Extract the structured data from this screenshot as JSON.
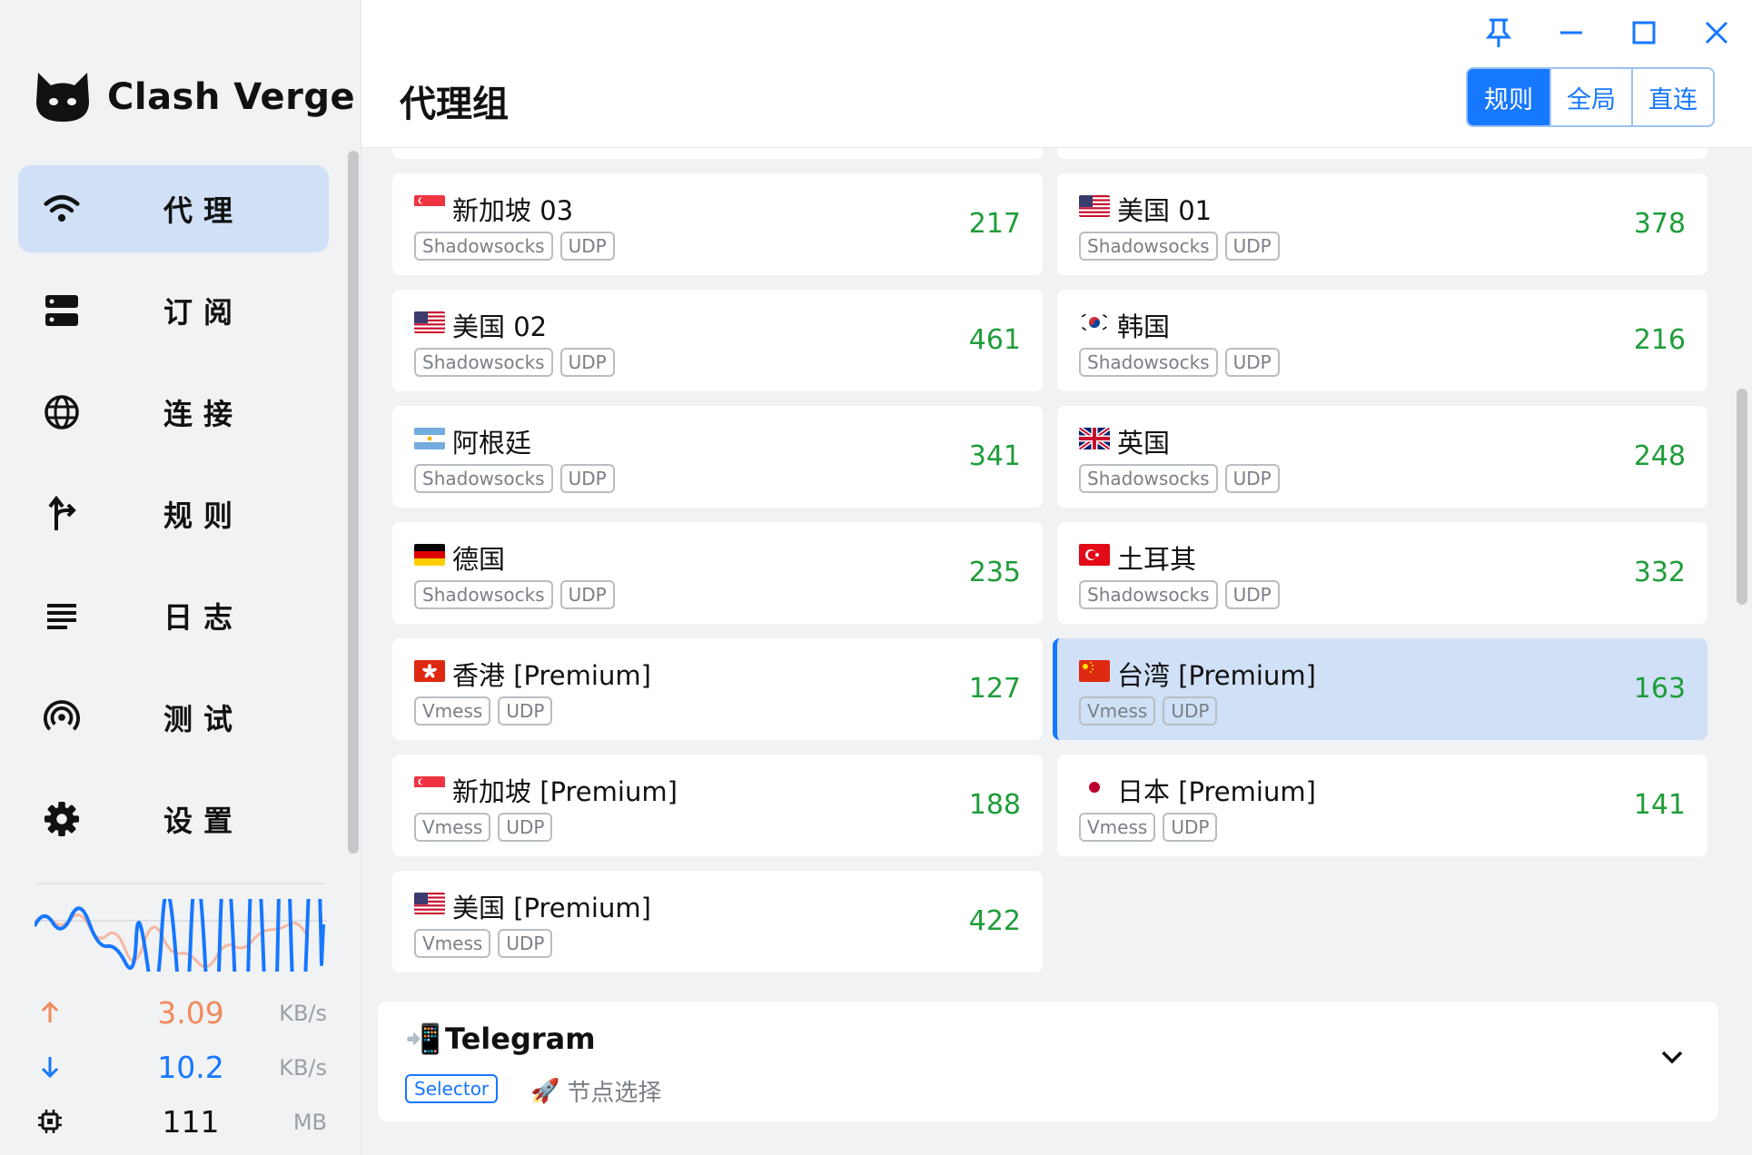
{
  "app": {
    "name": "Clash Verge"
  },
  "sidebar": {
    "items": [
      {
        "label": "代理",
        "icon": "wifi-icon",
        "active": true
      },
      {
        "label": "订阅",
        "icon": "server-icon",
        "active": false
      },
      {
        "label": "连接",
        "icon": "globe-icon",
        "active": false
      },
      {
        "label": "规则",
        "icon": "fork-icon",
        "active": false
      },
      {
        "label": "日志",
        "icon": "list-icon",
        "active": false
      },
      {
        "label": "测试",
        "icon": "broadcast-icon",
        "active": false
      },
      {
        "label": "设置",
        "icon": "gear-icon",
        "active": false
      }
    ],
    "stats": {
      "upload": {
        "value": "3.09",
        "unit": "KB/s",
        "color": "#f08a5d"
      },
      "download": {
        "value": "10.2",
        "unit": "KB/s",
        "color": "#1677ff"
      },
      "memory": {
        "value": "111",
        "unit": "MB"
      }
    }
  },
  "header": {
    "title": "代理组",
    "modes": [
      {
        "label": "规则",
        "active": true
      },
      {
        "label": "全局",
        "active": false
      },
      {
        "label": "直连",
        "active": false
      }
    ]
  },
  "proxies": [
    {
      "name": "新加坡 03",
      "flag": "sg",
      "tags": [
        "Shadowsocks",
        "UDP"
      ],
      "delay": "217"
    },
    {
      "name": "美国 01",
      "flag": "us",
      "tags": [
        "Shadowsocks",
        "UDP"
      ],
      "delay": "378"
    },
    {
      "name": "美国 02",
      "flag": "us",
      "tags": [
        "Shadowsocks",
        "UDP"
      ],
      "delay": "461"
    },
    {
      "name": "韩国",
      "flag": "kr",
      "tags": [
        "Shadowsocks",
        "UDP"
      ],
      "delay": "216"
    },
    {
      "name": "阿根廷",
      "flag": "ar",
      "tags": [
        "Shadowsocks",
        "UDP"
      ],
      "delay": "341"
    },
    {
      "name": "英国",
      "flag": "gb",
      "tags": [
        "Shadowsocks",
        "UDP"
      ],
      "delay": "248"
    },
    {
      "name": "德国",
      "flag": "de",
      "tags": [
        "Shadowsocks",
        "UDP"
      ],
      "delay": "235"
    },
    {
      "name": "土耳其",
      "flag": "tr",
      "tags": [
        "Shadowsocks",
        "UDP"
      ],
      "delay": "332"
    },
    {
      "name": "香港 [Premium]",
      "flag": "hk",
      "tags": [
        "Vmess",
        "UDP"
      ],
      "delay": "127"
    },
    {
      "name": "台湾 [Premium]",
      "flag": "cn",
      "tags": [
        "Vmess",
        "UDP"
      ],
      "delay": "163",
      "selected": true
    },
    {
      "name": "新加坡 [Premium]",
      "flag": "sg",
      "tags": [
        "Vmess",
        "UDP"
      ],
      "delay": "188"
    },
    {
      "name": "日本 [Premium]",
      "flag": "jp",
      "tags": [
        "Vmess",
        "UDP"
      ],
      "delay": "141"
    },
    {
      "name": "美国 [Premium]",
      "flag": "us",
      "tags": [
        "Vmess",
        "UDP"
      ],
      "delay": "422"
    }
  ],
  "group": {
    "emoji": "📲",
    "name": "Telegram",
    "type": "Selector",
    "now_emoji": "🚀",
    "now": "节点选择"
  },
  "colors": {
    "accent": "#1677ff",
    "delay": "#1f9d3a",
    "selected_bg": "#cfe0f7"
  }
}
